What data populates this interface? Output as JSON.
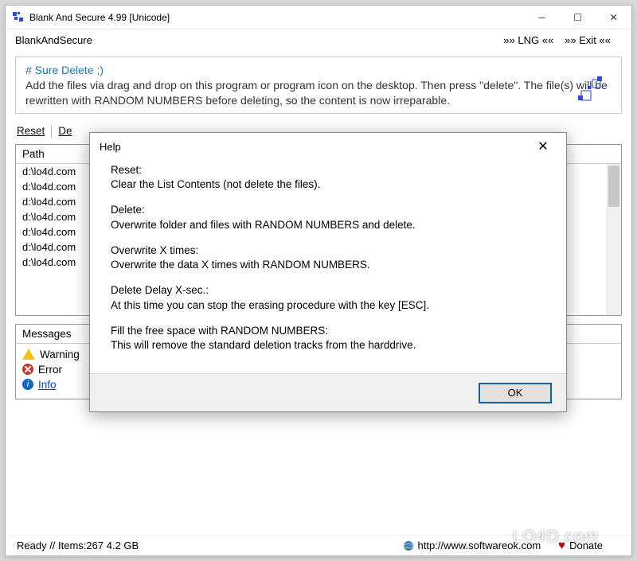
{
  "window": {
    "title": "Blank And Secure 4.99 [Unicode]"
  },
  "menubar": {
    "app_name": "BlankAndSecure",
    "lng": "»» LNG ««",
    "exit": "»» Exit ««"
  },
  "info": {
    "heading": "# Sure Delete ;)",
    "text": "Add the files via drag and drop on this program or program icon on the desktop. Then press \"delete\". The file(s) will be rewritten with RANDOM NUMBERS before deleting, so the content is now irreparable."
  },
  "actions": {
    "reset": "Reset",
    "delete_truncated": "De"
  },
  "file_panel": {
    "header": "Path",
    "rows": [
      "d:\\lo4d.com",
      "d:\\lo4d.com",
      "d:\\lo4d.com",
      "d:\\lo4d.com",
      "d:\\lo4d.com",
      "d:\\lo4d.com",
      "d:\\lo4d.com"
    ]
  },
  "messages": {
    "header": "Messages",
    "warning": "Warning",
    "error": "Error",
    "info": "Info"
  },
  "status": {
    "left": "Ready // Items:267 4.2 GB",
    "url": "http://www.softwareok.com",
    "donate": "Donate"
  },
  "dialog": {
    "title": "Help",
    "sections": [
      {
        "h": "Reset:",
        "b": "Clear the List Contents (not delete the files)."
      },
      {
        "h": "Delete:",
        "b": "Overwrite folder and files with RANDOM NUMBERS and delete."
      },
      {
        "h": "Overwrite X times:",
        "b": "Overwrite the data X times with RANDOM NUMBERS."
      },
      {
        "h": "Delete Delay X-sec.:",
        "b": "At this time you can stop the erasing procedure with the key [ESC]."
      },
      {
        "h": "Fill the free space with RANDOM NUMBERS:",
        "b": "This will remove the standard deletion tracks from the harddrive."
      }
    ],
    "ok": "OK"
  },
  "watermark": "LO4D.com"
}
